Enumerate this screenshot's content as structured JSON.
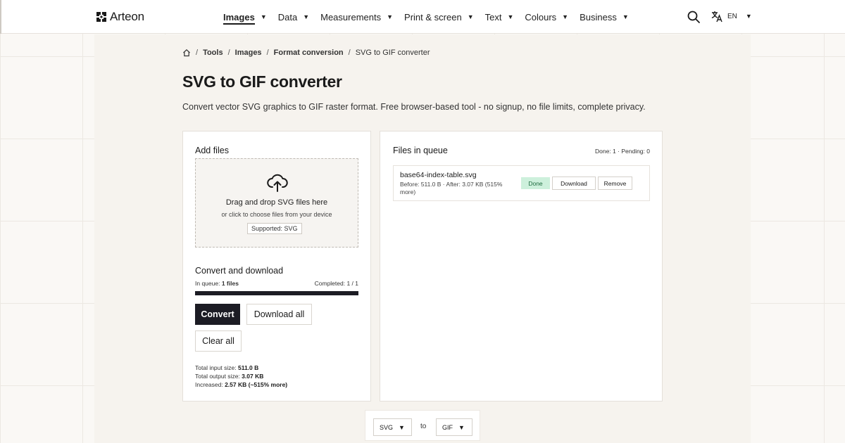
{
  "header": {
    "logo_text": "Arteon",
    "nav": [
      {
        "label": "Images",
        "active": true
      },
      {
        "label": "Data",
        "active": false
      },
      {
        "label": "Measurements",
        "active": false
      },
      {
        "label": "Print & screen",
        "active": false
      },
      {
        "label": "Text",
        "active": false
      },
      {
        "label": "Colours",
        "active": false
      },
      {
        "label": "Business",
        "active": false
      }
    ],
    "language": "EN",
    "icons": {
      "search": "search-icon",
      "translate": "translate-icon",
      "logo": "logo-mark-icon"
    }
  },
  "breadcrumb": {
    "items": [
      "Tools",
      "Images",
      "Format conversion"
    ],
    "current": "SVG to GIF converter"
  },
  "page": {
    "title": "SVG to GIF converter",
    "description": "Convert vector SVG graphics to GIF raster format. Free browser-based tool - no signup, no file limits, complete privacy."
  },
  "add_files": {
    "title": "Add files",
    "dropzone_title": "Drag and drop SVG files here",
    "dropzone_subtitle": "or click to choose files from your device",
    "supported": "Supported: SVG"
  },
  "convert": {
    "title": "Convert and download",
    "in_queue_label": "In queue:",
    "in_queue_value": "1 files",
    "completed": "Completed: 1 / 1",
    "progress": 1.0,
    "convert_label": "Convert",
    "download_all_label": "Download all",
    "clear_all_label": "Clear all",
    "total_input_label": "Total input size:",
    "total_input_value": "511.0 B",
    "total_output_label": "Total output size:",
    "total_output_value": "3.07 KB",
    "increased_label": "Increased:",
    "increased_value": "2.57 KB (~515% more)"
  },
  "queue": {
    "title": "Files in queue",
    "summary": "Done: 1 · Pending: 0",
    "files": [
      {
        "name": "base64-index-table.svg",
        "meta": "Before: 511.0 B · After: 3.07 KB (515% more)",
        "status": "Done",
        "download_label": "Download",
        "remove_label": "Remove"
      }
    ]
  },
  "format": {
    "from": "SVG",
    "to_label": "to",
    "to": "GIF"
  },
  "colors": {
    "accent_dark": "#1c1c24",
    "done_bg": "#cdf0dc",
    "done_text": "#1f6b3f",
    "background": "#faf8f5"
  }
}
